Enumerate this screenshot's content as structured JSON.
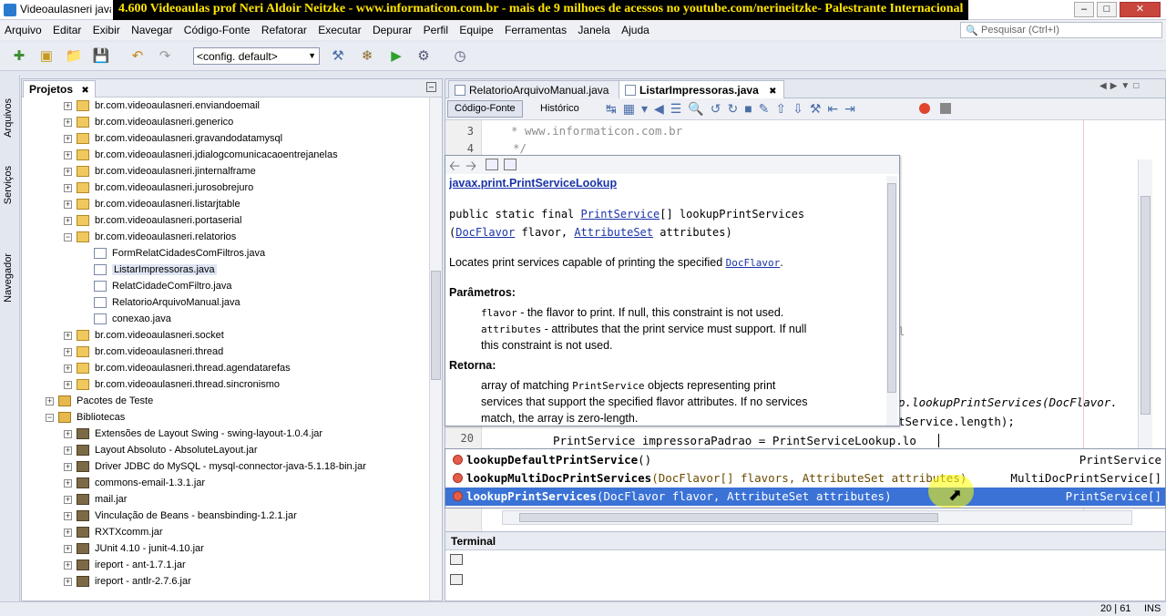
{
  "window": {
    "title": "Videoaulasneri java",
    "banner": "4.600 Videoaulas prof Neri Aldoir Neitzke - www.informaticon.com.br - mais de 9 milhoes de acessos no youtube.com/nerineitzke- Palestrante Internacional"
  },
  "menu": [
    "Arquivo",
    "Editar",
    "Exibir",
    "Navegar",
    "Código-Fonte",
    "Refatorar",
    "Executar",
    "Depurar",
    "Perfil",
    "Equipe",
    "Ferramentas",
    "Janela",
    "Ajuda"
  ],
  "search": {
    "placeholder": "Pesquisar (Ctrl+I)"
  },
  "toolbar": {
    "config": "<config. default>"
  },
  "side_tabs": [
    "Arquivos",
    "Serviços",
    "Navegador"
  ],
  "projects": {
    "title": "Projetos",
    "tree": [
      {
        "label": "br.com.videoaulasneri.enviandoemail",
        "type": "pkg",
        "lv": 2,
        "exp": "+"
      },
      {
        "label": "br.com.videoaulasneri.generico",
        "type": "pkg",
        "lv": 2,
        "exp": "+"
      },
      {
        "label": "br.com.videoaulasneri.gravandodatamysql",
        "type": "pkg",
        "lv": 2,
        "exp": "+"
      },
      {
        "label": "br.com.videoaulasneri.jdialogcomunicacaoentrejanelas",
        "type": "pkg",
        "lv": 2,
        "exp": "+"
      },
      {
        "label": "br.com.videoaulasneri.jinternalframe",
        "type": "pkg",
        "lv": 2,
        "exp": "+"
      },
      {
        "label": "br.com.videoaulasneri.jurosobrejuro",
        "type": "pkg",
        "lv": 2,
        "exp": "+"
      },
      {
        "label": "br.com.videoaulasneri.listarjtable",
        "type": "pkg",
        "lv": 2,
        "exp": "+"
      },
      {
        "label": "br.com.videoaulasneri.portaserial",
        "type": "pkg",
        "lv": 2,
        "exp": "+"
      },
      {
        "label": "br.com.videoaulasneri.relatorios",
        "type": "pkg",
        "lv": 2,
        "exp": "-"
      },
      {
        "label": "FormRelatCidadesComFiltros.java",
        "type": "file",
        "lv": 3,
        "exp": ""
      },
      {
        "label": "ListarImpressoras.java",
        "type": "file",
        "lv": 3,
        "exp": "",
        "selected": true
      },
      {
        "label": "RelatCidadeComFiltro.java",
        "type": "file",
        "lv": 3,
        "exp": ""
      },
      {
        "label": "RelatorioArquivoManual.java",
        "type": "file",
        "lv": 3,
        "exp": ""
      },
      {
        "label": "conexao.java",
        "type": "file",
        "lv": 3,
        "exp": ""
      },
      {
        "label": "br.com.videoaulasneri.socket",
        "type": "pkg",
        "lv": 2,
        "exp": "+"
      },
      {
        "label": "br.com.videoaulasneri.thread",
        "type": "pkg",
        "lv": 2,
        "exp": "+"
      },
      {
        "label": "br.com.videoaulasneri.thread.agendatarefas",
        "type": "pkg",
        "lv": 2,
        "exp": "+"
      },
      {
        "label": "br.com.videoaulasneri.thread.sincronismo",
        "type": "pkg",
        "lv": 2,
        "exp": "+"
      },
      {
        "label": "Pacotes de Teste",
        "type": "folder",
        "lv": 1,
        "exp": "+"
      },
      {
        "label": "Bibliotecas",
        "type": "folder",
        "lv": 1,
        "exp": "-"
      },
      {
        "label": "Extensões de Layout Swing - swing-layout-1.0.4.jar",
        "type": "jar",
        "lv": 2,
        "exp": "+"
      },
      {
        "label": "Layout Absoluto - AbsoluteLayout.jar",
        "type": "jar",
        "lv": 2,
        "exp": "+"
      },
      {
        "label": "Driver JDBC do MySQL - mysql-connector-java-5.1.18-bin.jar",
        "type": "jar",
        "lv": 2,
        "exp": "+"
      },
      {
        "label": "commons-email-1.3.1.jar",
        "type": "jar",
        "lv": 2,
        "exp": "+"
      },
      {
        "label": "mail.jar",
        "type": "jar",
        "lv": 2,
        "exp": "+"
      },
      {
        "label": "Vinculação de Beans - beansbinding-1.2.1.jar",
        "type": "jar",
        "lv": 2,
        "exp": "+"
      },
      {
        "label": "RXTXcomm.jar",
        "type": "jar",
        "lv": 2,
        "exp": "+"
      },
      {
        "label": "JUnit 4.10 - junit-4.10.jar",
        "type": "jar",
        "lv": 2,
        "exp": "+"
      },
      {
        "label": "ireport - ant-1.7.1.jar",
        "type": "jar",
        "lv": 2,
        "exp": "+"
      },
      {
        "label": "ireport - antlr-2.7.6.jar",
        "type": "jar",
        "lv": 2,
        "exp": "+"
      }
    ]
  },
  "editor": {
    "tabs": [
      {
        "label": "RelatorioArquivoManual.java",
        "active": false
      },
      {
        "label": "ListarImpressoras.java",
        "active": true
      }
    ],
    "modes": [
      "Código-Fonte",
      "Histórico"
    ],
    "lines": [
      {
        "num": "3",
        "text": "* www.informaticon.com.br"
      },
      {
        "num": "4",
        "text": "*/"
      },
      {
        "num": "20",
        "text": "PrintService impressoraPadrao = PrintServiceLookup.lo"
      }
    ],
    "code_fragments": [
      "p.lookupPrintServices(DocFlavor.",
      "tService.length);",
      "l"
    ]
  },
  "javadoc": {
    "class": "javax.print.PrintServiceLookup",
    "signature_prefix": "public static final",
    "return_type": "PrintService",
    "signature_suffix": "[] lookupPrintServices",
    "param1_type": "DocFlavor",
    "param1_name": "flavor,",
    "param2_type": "AttributeSet",
    "param2_name": "attributes)",
    "open_paren": "(",
    "desc_prefix": "Locates print services capable of printing the specified",
    "desc_link": "DocFlavor",
    "desc_suffix": ".",
    "params_heading": "Parâmetros:",
    "p1_code": "flavor",
    "p1_text": "- the flavor to print. If null, this constraint is not used.",
    "p2_code": "attributes",
    "p2_text": "- attributes that the print service must support. If null",
    "p2_text2": "this constraint is not used.",
    "returns_heading": "Retorna:",
    "r1_prefix": "array of matching",
    "r1_code": "PrintService",
    "r1_suffix": "objects representing print",
    "r2": "services that support the specified flavor attributes. If no services",
    "r3": "match, the array is zero-length."
  },
  "completion": [
    {
      "name": "lookupDefaultPrintService",
      "args": "()",
      "type": "PrintService",
      "selected": false
    },
    {
      "name": "lookupMultiDocPrintServices",
      "args": "(DocFlavor[] flavors, AttributeSet attributes)",
      "type": "MultiDocPrintService[]",
      "selected": false
    },
    {
      "name": "lookupPrintServices",
      "args": "(DocFlavor flavor, AttributeSet attributes)",
      "type": "PrintService[]",
      "selected": true
    }
  ],
  "terminal": {
    "title": "Terminal"
  },
  "status": {
    "position": "20 | 61",
    "mode": "INS"
  }
}
